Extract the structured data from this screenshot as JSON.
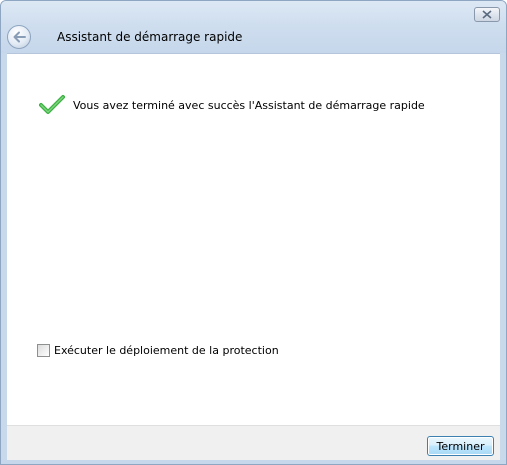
{
  "window": {
    "title": "Assistant de démarrage rapide"
  },
  "success": {
    "message": "Vous avez terminé avec succès l'Assistant de démarrage rapide"
  },
  "options": {
    "run_deployment_label": "Exécuter le déploiement de la protection",
    "run_deployment_checked": false
  },
  "footer": {
    "finish_label": "Terminer"
  },
  "colors": {
    "success_check": "#3cb043",
    "accent_border": "#3c7fb1"
  },
  "icons": {
    "close": "close-icon",
    "back": "back-arrow-icon",
    "success": "checkmark-icon"
  }
}
